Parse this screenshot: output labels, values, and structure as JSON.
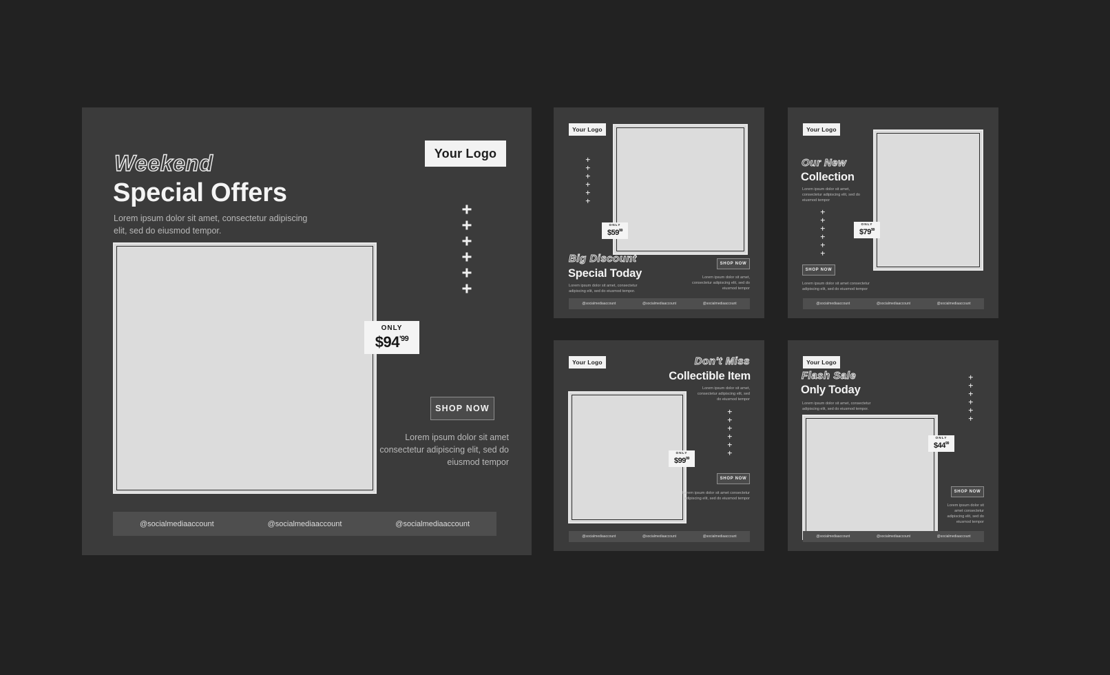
{
  "theme": {
    "page_background": "#222222",
    "card_background": "#3b3b3b",
    "accent_light": "#f2f2f2",
    "image_placeholder": "#dcdcdc",
    "social_bar": "#4e4e4e",
    "button_fill": "#4a4a4a",
    "button_border": "#8f8f8f",
    "body_text": "#b9b9b9"
  },
  "common": {
    "logo_label": "Your Logo",
    "shop_now_label": "SHOP NOW",
    "price_only_label": "ONLY",
    "social_handle": "@socialmediaaccount",
    "decor_icon": "plus-sparkle-icon",
    "plus_count": 6
  },
  "hero": {
    "logo_label": "Your Logo",
    "headline_outline": "Weekend",
    "headline_solid": "Special Offers",
    "subtitle": "Lorem ipsum dolor sit amet, consectetur adipiscing elit, sed do eiusmod tempor.",
    "price": {
      "only_label": "ONLY",
      "currency": "$",
      "amount": "94",
      "cents": "'99"
    },
    "shop_now_label": "SHOP NOW",
    "footer_text": "Lorem ipsum dolor sit amet consectetur adipiscing elit, sed do eiusmod tempor",
    "social": [
      "@socialmediaaccount",
      "@socialmediaaccount",
      "@socialmediaaccount"
    ]
  },
  "cards": [
    {
      "id": "big-discount",
      "logo_label": "Your Logo",
      "headline_outline": "Big Discount",
      "headline_solid": "Special Today",
      "subtitle": "Lorem ipsum dolor sit amet, consectetur adipiscing elit, sed do eiusmod tempor.",
      "price": {
        "only_label": "ONLY",
        "currency": "$",
        "amount": "59",
        "cents": "99"
      },
      "shop_now_label": "SHOP NOW",
      "side_text": "Lorem ipsum dolor sit amet, consectetur adipiscing elit, sed do eiusmod tempor",
      "social": [
        "@socialmediaaccount",
        "@socialmediaaccount",
        "@socialmediaaccount"
      ]
    },
    {
      "id": "our-new-collection",
      "logo_label": "Your Logo",
      "headline_outline": "Our New",
      "headline_solid": "Collection",
      "subtitle": "Lorem ipsum dolor sit amet, consectetur adipiscing elit, sed do eiusmod tempor",
      "price": {
        "only_label": "ONLY",
        "currency": "$",
        "amount": "79",
        "cents": "99"
      },
      "shop_now_label": "SHOP NOW",
      "side_text": "Lorem ipsum dolor sit amet consectetur adipiscing elit, sed do eiusmod tempor",
      "social": [
        "@socialmediaaccount",
        "@socialmediaaccount",
        "@socialmediaaccount"
      ]
    },
    {
      "id": "collectible-item",
      "logo_label": "Your Logo",
      "headline_outline": "Don't Miss",
      "headline_solid": "Collectible Item",
      "subtitle": "Lorem ipsum dolor sit amet, consectetur adipiscing elit, sed do eiusmod tempor",
      "price": {
        "only_label": "ONLY",
        "currency": "$",
        "amount": "99",
        "cents": "99"
      },
      "shop_now_label": "SHOP NOW",
      "side_text": "Lorem ipsum dolor sit amet consectetur adipiscing elit, sed do eiusmod tempor",
      "social": [
        "@socialmediaaccount",
        "@socialmediaaccount",
        "@socialmediaaccount"
      ]
    },
    {
      "id": "flash-sale",
      "logo_label": "Your Logo",
      "headline_outline": "Flash Sale",
      "headline_solid": "Only Today",
      "subtitle": "Lorem ipsum dolor sit amet, consectetur adipiscing elit, sed do eiusmod tempor.",
      "price": {
        "only_label": "ONLY",
        "currency": "$",
        "amount": "44",
        "cents": "99"
      },
      "shop_now_label": "SHOP NOW",
      "side_text": "Lorem ipsum dolor sit amet consectetur adipiscing elit, sed do eiusmod tempor",
      "social": [
        "@socialmediaaccount",
        "@socialmediaaccount",
        "@socialmediaaccount"
      ]
    }
  ]
}
